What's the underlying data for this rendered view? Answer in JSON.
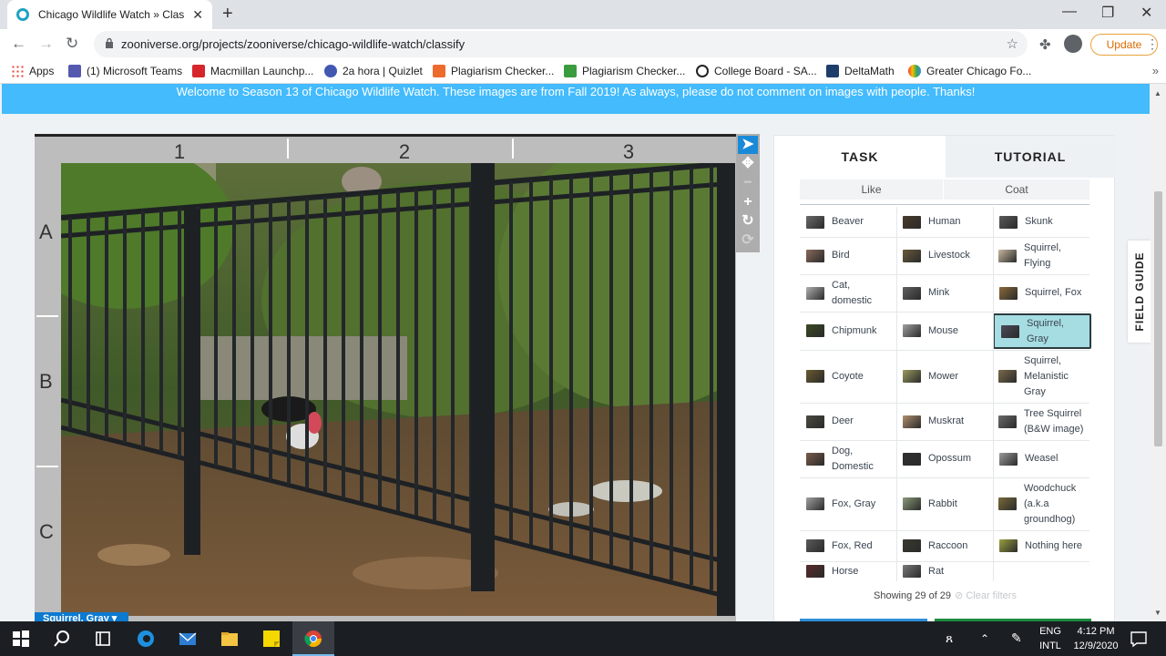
{
  "browser": {
    "tab_title": "Chicago Wildlife Watch » Classify",
    "url": "zooniverse.org/projects/zooniverse/chicago-wildlife-watch/classify",
    "update_label": "Update",
    "bookmarks": [
      "Apps",
      "(1) Microsoft Teams",
      "Macmillan Launchp...",
      "2a hora | Quizlet",
      "Plagiarism Checker...",
      "Plagiarism Checker...",
      "College Board - SA...",
      "DeltaMath",
      "Greater Chicago Fo..."
    ]
  },
  "banner": {
    "text": "Welcome to Season 13 of Chicago Wildlife Watch. These images are from Fall 2019! As always, please do not comment on images with people. Thanks!"
  },
  "viewer": {
    "columns": [
      "1",
      "2",
      "3"
    ],
    "rows": [
      "A",
      "B",
      "C"
    ],
    "selected_tag": "Squirrel, Gray ▾"
  },
  "panel": {
    "tabs": [
      "TASK",
      "TUTORIAL"
    ],
    "filters": [
      "Like",
      "Coat"
    ],
    "species": [
      [
        "Beaver",
        "Human",
        "Skunk"
      ],
      [
        "Bird",
        "Livestock",
        "Squirrel, Flying"
      ],
      [
        "Cat, domestic",
        "Mink",
        "Squirrel, Fox"
      ],
      [
        "Chipmunk",
        "Mouse",
        "Squirrel, Gray"
      ],
      [
        "Coyote",
        "Mower",
        "Squirrel, Melanistic Gray"
      ],
      [
        "Deer",
        "Muskrat",
        "Tree Squirrel (B&W image)"
      ],
      [
        "Dog, Domestic",
        "Opossum",
        "Weasel"
      ],
      [
        "Fox, Gray",
        "Rabbit",
        "Woodchuck (a.k.a groundhog)"
      ],
      [
        "Fox, Red",
        "Raccoon",
        "Nothing here"
      ],
      [
        "Horse",
        "Rat",
        ""
      ]
    ],
    "selected_species": "Squirrel, Gray",
    "showing_text": "Showing 29 of 29",
    "clear_filters": "⊘ Clear filters",
    "field_guide": "FIELD GUIDE"
  },
  "taskbar": {
    "lang_top": "ENG",
    "lang_bottom": "INTL",
    "time": "4:12 PM",
    "date": "12/9/2020"
  },
  "colors": {
    "banner": "#43bbfd",
    "selected": "#a6dde3",
    "update_accent": "#d96b00"
  }
}
